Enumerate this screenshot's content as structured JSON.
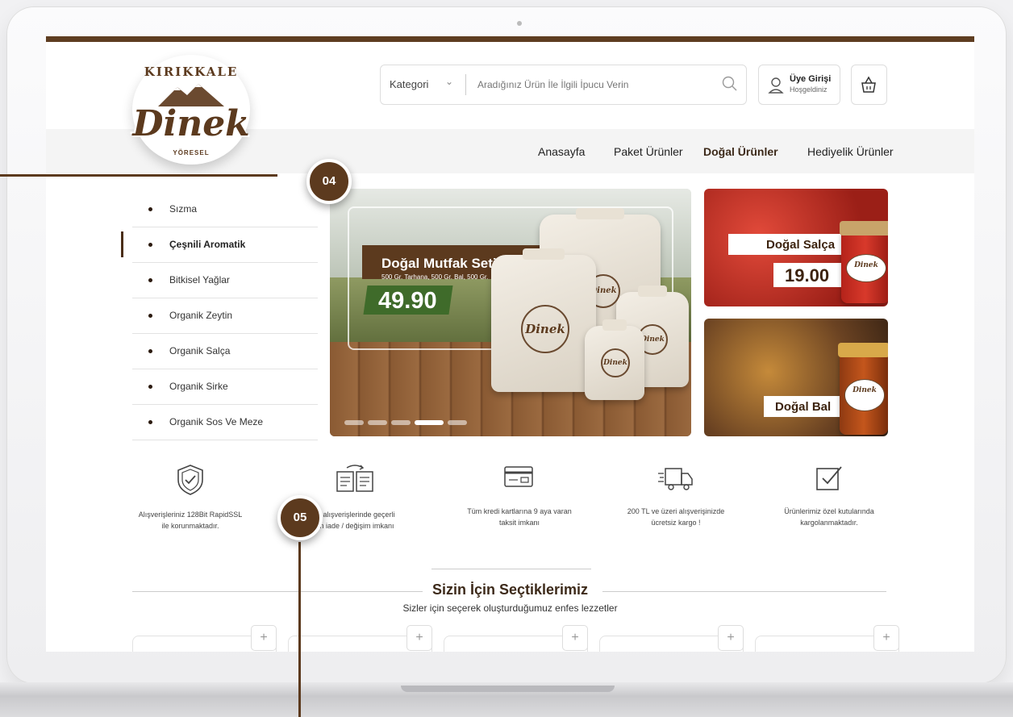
{
  "logo": {
    "arc_text": "KIRIKKALE",
    "script_text": "Dinek",
    "sub_text": "YÖRESEL"
  },
  "search": {
    "category_label": "Kategori",
    "placeholder": "Aradığınız Ürün İle İlgili İpucu Verin",
    "icon": "search-icon"
  },
  "account": {
    "title": "Üye Girişi",
    "subtitle": "Hoşgeldiniz",
    "icon": "user-icon"
  },
  "cart": {
    "icon": "basket-icon"
  },
  "nav": {
    "items": [
      {
        "label": "Anasayfa"
      },
      {
        "label": "Paket Ürünler"
      },
      {
        "label": "Doğal Ürünler",
        "active": true
      },
      {
        "label": "Hediyelik Ürünler"
      }
    ]
  },
  "sidebar": {
    "items": [
      {
        "label": "Sızma"
      },
      {
        "label": "Çeşnili Aromatik",
        "active": true
      },
      {
        "label": "Bitkisel Yağlar"
      },
      {
        "label": "Organik Zeytin"
      },
      {
        "label": "Organik Salça"
      },
      {
        "label": "Organik Sirke"
      },
      {
        "label": "Organik Sos Ve Meze"
      }
    ]
  },
  "hero": {
    "title": "Doğal Mutfak Seti",
    "subtitle": "500 Gr. Tarhana, 500 Gr. Bal, 500 Gr.",
    "price": "49.90",
    "bag_brand": "Dinek",
    "slides": 5,
    "active_slide": 4
  },
  "promos": [
    {
      "title": "Doğal Salça",
      "price": "19.00",
      "jar_brand": "Dinek"
    },
    {
      "title": "Doğal Bal",
      "jar_brand": "Dinek"
    }
  ],
  "features": [
    {
      "icon": "shield-check-icon",
      "line1": "Alışverişleriniz 128Bit RapidSSL",
      "line2": "ile korunmaktadır."
    },
    {
      "icon": "exchange-icon",
      "line1": "et alışverişlerinde geçerli",
      "line2": "ün iade / değişim imkanı"
    },
    {
      "icon": "credit-card-icon",
      "line1": "Tüm kredi kartlarına 9 aya varan",
      "line2": "taksit imkanı"
    },
    {
      "icon": "truck-icon",
      "line1": "200 TL ve üzeri alışverişinizde",
      "line2": "ücretsiz kargo !"
    },
    {
      "icon": "checkbox-icon",
      "line1": "Ürünlerimiz özel kutularında",
      "line2": "kargolanmaktadır."
    }
  ],
  "section": {
    "title": "Sizin İçin Seçtiklerimiz",
    "subtitle": "Sizler için seçerek oluşturduğumuz enfes lezzetler"
  },
  "product_cards": [
    {
      "add": "+"
    },
    {
      "add": "+"
    },
    {
      "add": "+"
    },
    {
      "add": "+"
    },
    {
      "add": "+"
    }
  ],
  "callouts": [
    {
      "number": "04"
    },
    {
      "number": "05"
    }
  ],
  "colors": {
    "brand_brown": "#5e3d21",
    "price_green": "#3f6b2a"
  }
}
